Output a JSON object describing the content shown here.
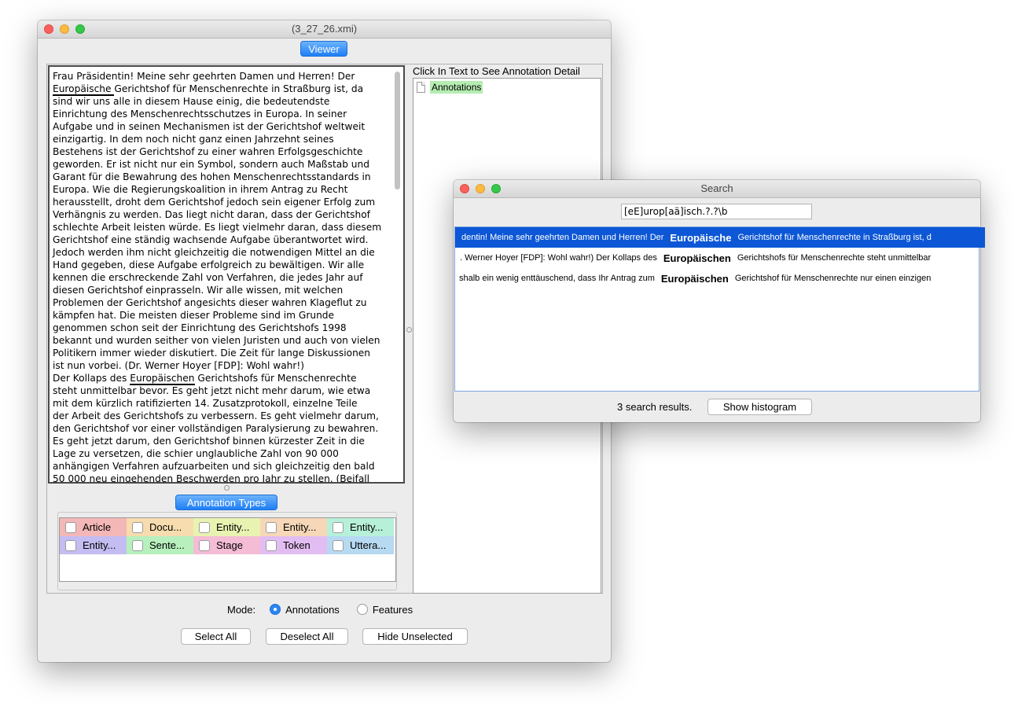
{
  "main_window": {
    "title": "(3_27_26.xmi)",
    "viewer_button": "Viewer",
    "document": {
      "segments": [
        {
          "text": "Frau Präsidentin! Meine sehr geehrten Damen und Herren! Der\n",
          "hl": false
        },
        {
          "text": "Europäische ",
          "hl": true
        },
        {
          "text": "Gerichtshof für Menschenrechte in Straßburg ist, da\nsind wir uns alle in diesem Hause einig, die bedeutendste\nEinrichtung des Menschenrechtsschutzes in Europa. In seiner\nAufgabe und in seinen Mechanismen ist der Gerichtshof weltweit\neinzigartig. In dem noch nicht ganz einen Jahrzehnt seines\nBestehens ist der Gerichtshof zu einer wahren Erfolgsgeschichte\ngeworden. Er ist nicht nur ein Symbol, sondern auch Maßstab und\nGarant für die Bewahrung des hohen Menschenrechtsstandards in\nEuropa. Wie die Regierungskoalition in ihrem Antrag zu Recht\nherausstellt, droht dem Gerichtshof jedoch sein eigener Erfolg zum\nVerhängnis zu werden. Das liegt nicht daran, dass der Gerichtshof\nschlechte Arbeit leisten würde. Es liegt vielmehr daran, dass diesem\nGerichtshof eine ständig wachsende Aufgabe überantwortet wird.\nJedoch werden ihm nicht gleichzeitig die notwendigen Mittel an die\nHand gegeben, diese Aufgabe erfolgreich zu bewältigen. Wir alle\nkennen die erschreckende Zahl von Verfahren, die jedes Jahr auf\ndiesen Gerichtshof einprasseln. Wir alle wissen, mit welchen\nProblemen der Gerichtshof angesichts dieser wahren Klageflut zu\nkämpfen hat. Die meisten dieser Probleme sind im Grunde\ngenommen schon seit der Einrichtung des Gerichtshofs 1998\nbekannt und wurden seither von vielen Juristen und auch von vielen\nPolitikern immer wieder diskutiert. Die Zeit für lange Diskussionen\nist nun vorbei. (Dr. Werner Hoyer [FDP]: Wohl wahr!)\nDer Kollaps des ",
          "hl": false
        },
        {
          "text": "Europäischen",
          "hl": true
        },
        {
          "text": " Gerichtshofs für Menschenrechte\nsteht unmittelbar bevor. Es geht jetzt nicht mehr darum, wie etwa\nmit dem kürzlich ratifizierten 14. Zusatzprotokoll, einzelne Teile\nder Arbeit des Gerichtshofs zu verbessern. Es geht vielmehr darum,\nden Gerichtshof vor einer vollständigen Paralysierung zu bewahren.\nEs geht jetzt darum, den Gerichtshof binnen kürzester Zeit in die\nLage zu versetzen, die schier unglaubliche Zahl von 90 000\nanhängigen Verfahren aufzuarbeiten und sich gleichzeitig den bald\n50 000 neu eingehenden Beschwerden pro Jahr zu stellen. (Beifall",
          "hl": false
        }
      ]
    },
    "annotation_detail": {
      "heading": "Click In Text to See Annotation Detail",
      "tree_root": "Annotations",
      "tree_root_color": "#b5ecb1"
    },
    "annotation_types": {
      "title": "Annotation Types",
      "items": [
        {
          "label": "Article",
          "color": "#f4b7b7"
        },
        {
          "label": "Docu...",
          "color": "#f6dcae"
        },
        {
          "label": "Entity...",
          "color": "#e8f3b1"
        },
        {
          "label": "Entity...",
          "color": "#f6d7b7"
        },
        {
          "label": "Entity...",
          "color": "#b7f0d9"
        },
        {
          "label": "Entity...",
          "color": "#c3bdf2"
        },
        {
          "label": "Sente...",
          "color": "#b7f0bd"
        },
        {
          "label": "Stage",
          "color": "#f5bcd6"
        },
        {
          "label": "Token",
          "color": "#e2bdf2"
        },
        {
          "label": "Uttera...",
          "color": "#b7d9f2"
        }
      ]
    },
    "mode": {
      "label": "Mode:",
      "annotations": "Annotations",
      "features": "Features",
      "selected": "annotations"
    },
    "buttons": {
      "select_all": "Select All",
      "deselect_all": "Deselect All",
      "hide_unselected": "Hide Unselected"
    }
  },
  "search_window": {
    "title": "Search",
    "query": "[eE]urop[aä]isch.?.?\\b",
    "results": [
      {
        "left": "dentin! Meine sehr geehrten Damen und Herren! Der",
        "match": "Europäische",
        "right": "Gerichtshof für Menschenrechte in Straßburg ist, d"
      },
      {
        "left": ". Werner Hoyer [FDP]: Wohl wahr!) Der Kollaps des",
        "match": "Europäischen",
        "right": "Gerichtshofs für Menschenrechte steht unmittelbar"
      },
      {
        "left": "shalb ein wenig enttäuschend, dass Ihr Antrag zum",
        "match": "Europäischen",
        "right": "Gerichtshof für Menschenrechte nur einen einzigen"
      }
    ],
    "result_count": "3 search results.",
    "histogram_button": "Show histogram"
  },
  "colors": {
    "selection": "#0d57d6",
    "accent": "#1e7ef6"
  }
}
